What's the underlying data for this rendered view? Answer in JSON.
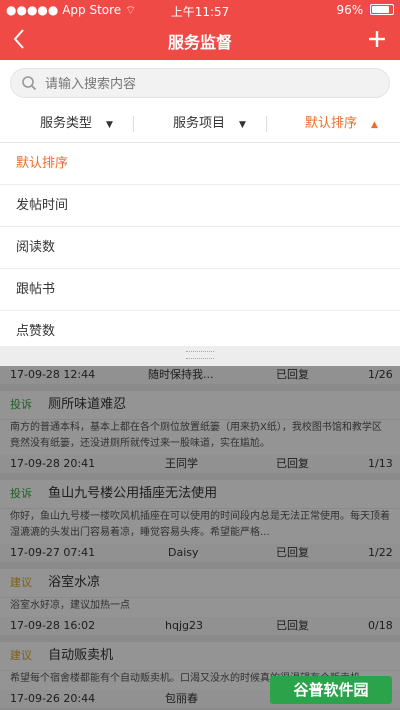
{
  "status": {
    "carrier": "App Store",
    "signal": "●●●●●",
    "time": "上午11:57",
    "battery": "96%",
    "battery_level": 0.96
  },
  "nav": {
    "title": "服务监督",
    "back_icon": "chevron-left-icon",
    "add_icon": "plus-icon"
  },
  "search": {
    "placeholder": "请输入搜索内容",
    "value": ""
  },
  "filters": {
    "service_type": "服务类型",
    "service_item": "服务项目",
    "sort": "默认排序"
  },
  "sort_options": [
    "默认排序",
    "发帖时间",
    "阅读数",
    "跟帖书",
    "点赞数"
  ],
  "selected_sort": 0,
  "posts": [
    {
      "meta": [
        "17-09-28 12:44",
        "随时保持我...",
        "已回复",
        "1/26"
      ]
    },
    {
      "tag": "投诉",
      "tag_type": "complain",
      "title": "厕所味道难忍",
      "body": "南方的普通本科，基本上都在各个厕位放置纸篓（用来扔X纸），我校图书馆和教学区竟然没有纸篓，还没进厕所就传过来一股味道，实在尴尬。",
      "meta": [
        "17-09-28 20:41",
        "王同学",
        "已回复",
        "1/13"
      ]
    },
    {
      "tag": "投诉",
      "tag_type": "complain",
      "title": "鱼山九号楼公用插座无法使用",
      "body": "你好，鱼山九号楼一楼吹风机插座在可以使用的时间段内总是无法正常使用。每天顶着湿漉漉的头发出门容易着凉，睡觉容易头疼。希望能严格...",
      "meta": [
        "17-09-27 07:41",
        "Daisy",
        "已回复",
        "1/22"
      ]
    },
    {
      "tag": "建议",
      "tag_type": "suggest",
      "title": "浴室水凉",
      "body": "浴室水好凉，建议加热一点",
      "meta": [
        "17-09-28 16:02",
        "hqjg23",
        "已回复",
        "0/18"
      ]
    },
    {
      "tag": "建议",
      "tag_type": "suggest",
      "title": "自动贩卖机",
      "body": "希望每个宿舍楼都能有个自动贩卖机。口渴又没水的时候真的很渴望有个贩卖机。",
      "meta": [
        "17-09-26 20:44",
        "包丽春",
        "已回复",
        "0/23"
      ]
    }
  ],
  "watermark": "谷普软件园"
}
